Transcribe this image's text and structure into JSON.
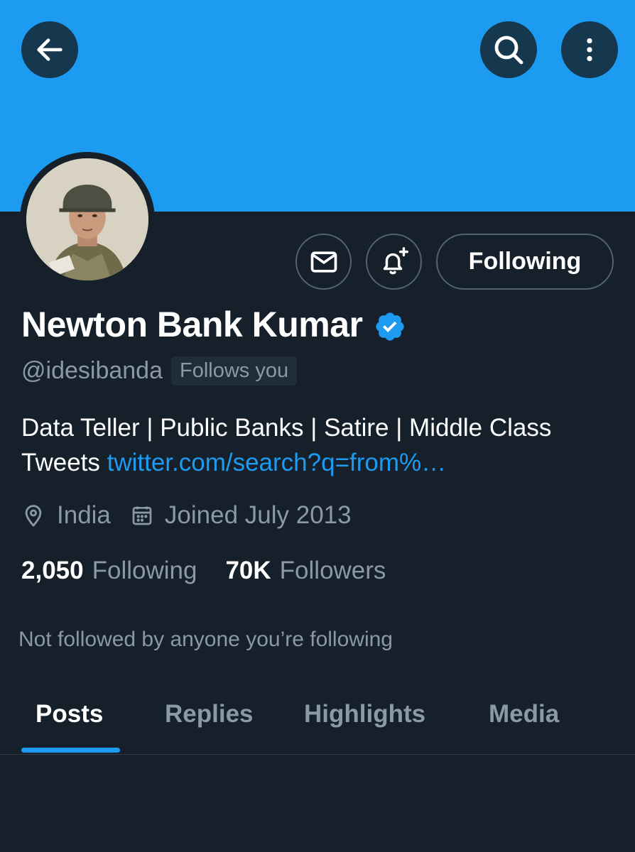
{
  "colors": {
    "banner": "#1d9bf0",
    "background": "#15202b",
    "accent": "#1d9bf0",
    "muted_text": "#8b98a5",
    "border": "#536471"
  },
  "header": {
    "back_icon": "arrow-left-icon",
    "search_icon": "search-icon",
    "more_icon": "more-vertical-icon"
  },
  "profile": {
    "avatar": "profile-avatar",
    "name": "Newton Bank Kumar",
    "verified": true,
    "handle": "@idesibanda",
    "follows_you_label": "Follows you",
    "bio_text": "Data Teller | Public Banks | Satire | Middle Class Tweets ",
    "bio_link": "twitter.com/search?q=from%…",
    "location": "India",
    "joined": "Joined July 2013",
    "following_count": "2,050",
    "following_label": "Following",
    "followers_count": "70K",
    "followers_label": "Followers",
    "mutuals_text": "Not followed by anyone you’re following"
  },
  "actions": {
    "message_icon": "envelope-icon",
    "notify_icon": "bell-plus-icon",
    "following_button_label": "Following"
  },
  "tabs": [
    {
      "label": "Posts",
      "active": true
    },
    {
      "label": "Replies",
      "active": false
    },
    {
      "label": "Highlights",
      "active": false
    },
    {
      "label": "Media",
      "active": false
    }
  ]
}
